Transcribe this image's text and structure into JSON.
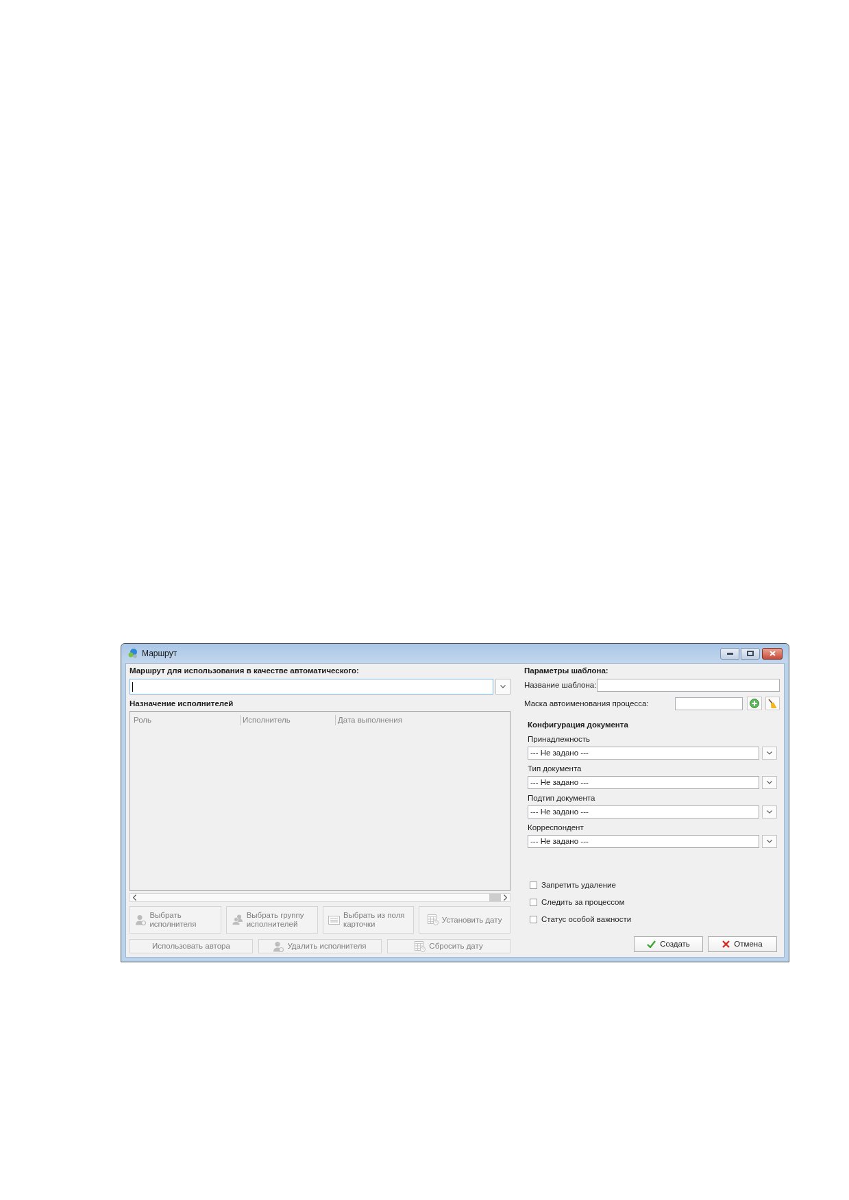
{
  "window": {
    "title": "Маршрут"
  },
  "route": {
    "label": "Маршрут для использования в качестве автоматического:",
    "focused": true
  },
  "executors": {
    "title": "Назначение исполнителей",
    "disabled": true,
    "columns": [
      "Роль",
      "Исполнитель",
      "Дата выполнения"
    ]
  },
  "executor_buttons": [
    {
      "label": "Выбрать исполнителя",
      "disabled": true
    },
    {
      "label": "Выбрать группу исполнителей",
      "disabled": true
    },
    {
      "label": "Выбрать из поля карточки",
      "disabled": true
    },
    {
      "label": "Установить дату",
      "disabled": true
    }
  ],
  "executor_buttons_2": [
    {
      "label": "Использовать автора",
      "disabled": true
    },
    {
      "label": "Удалить исполнителя",
      "disabled": true
    },
    {
      "label": "Сбросить дату",
      "disabled": true
    }
  ],
  "template": {
    "title": "Параметры шаблона:",
    "name_label": "Название шаблона:",
    "mask_label": "Маска автоименования процесса:"
  },
  "document_config": {
    "title": "Конфигурация документа",
    "fields": [
      {
        "label": "Принадлежность",
        "value": "--- Не задано ---"
      },
      {
        "label": "Тип документа",
        "value": "--- Не задано ---"
      },
      {
        "label": "Подтип документа",
        "value": "--- Не задано ---"
      },
      {
        "label": "Корреспондент",
        "value": "--- Не задано ---"
      }
    ]
  },
  "options": [
    {
      "label": "Запретить удаление",
      "checked": false
    },
    {
      "label": "Следить за процессом",
      "checked": false
    },
    {
      "label": "Статус особой важности",
      "checked": false
    }
  ],
  "actions": [
    {
      "label": "Создать",
      "kind": "confirm"
    },
    {
      "label": "Отмена",
      "kind": "cancel"
    }
  ]
}
